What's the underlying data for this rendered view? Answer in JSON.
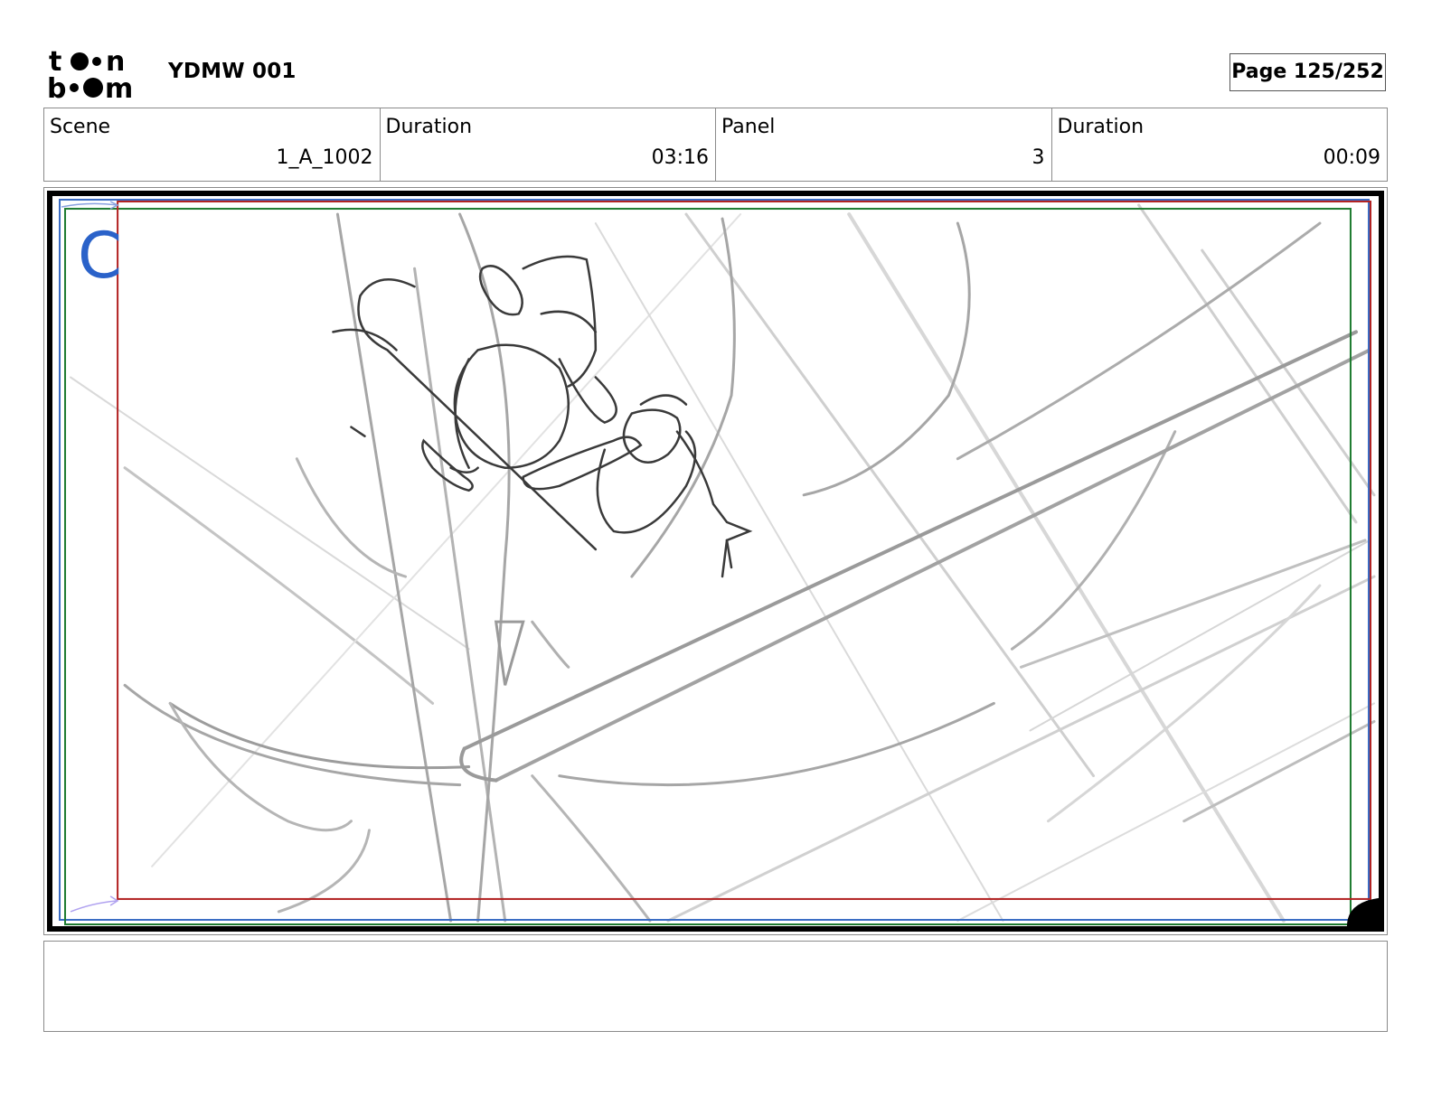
{
  "header": {
    "logo_text": "toon boom",
    "project_title": "YDMW 001",
    "page_indicator": "Page 125/252"
  },
  "info": {
    "scene_label": "Scene",
    "scene_value": "1_A_1002",
    "scene_duration_label": "Duration",
    "scene_duration_value": "03:16",
    "panel_label": "Panel",
    "panel_value": "3",
    "panel_duration_label": "Duration",
    "panel_duration_value": "00:09"
  },
  "panel": {
    "camera_label": "C",
    "colors": {
      "camera_label": "#2a62c9",
      "safe_frame_red": "#b22222",
      "safe_frame_green": "#1e7b30",
      "safe_frame_blue": "#3a6cc4",
      "sketch_dark": "#3a3a3a",
      "sketch_light": "#bdbdbd"
    }
  },
  "notes": {
    "text": ""
  }
}
